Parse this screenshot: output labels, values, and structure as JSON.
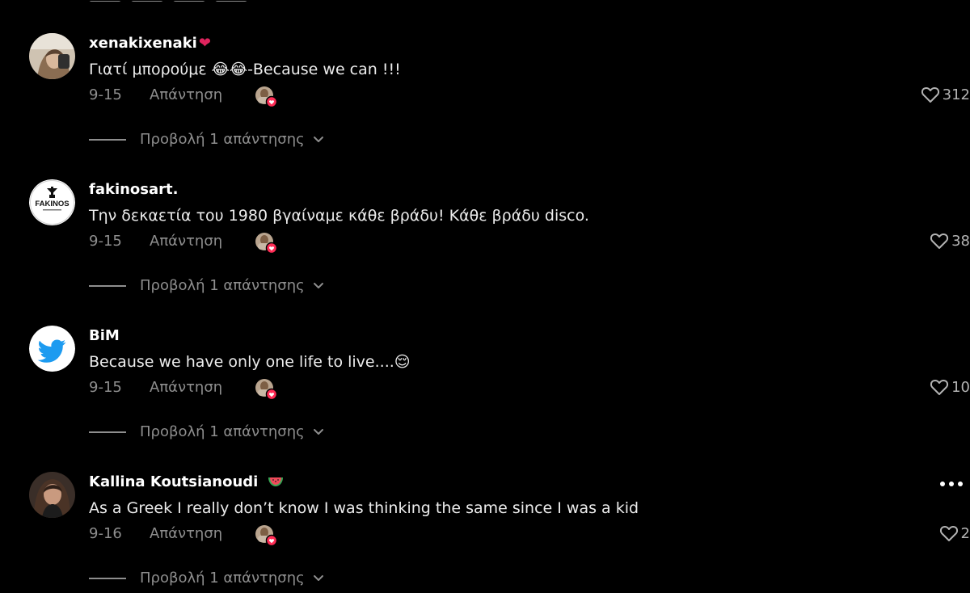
{
  "comments": [
    {
      "username": "xenakixenaki",
      "username_badge": "❤️",
      "text": "Γιατί μπορούμε 😂😂-Because we can !!!",
      "date": "9-15",
      "reply_label": "Απάντηση",
      "likes": "312",
      "view_replies": "Προβολή 1 απάντησης",
      "avatar": "woman-selfie-avatar",
      "has_more_menu": false
    },
    {
      "username": "fakinosart.",
      "username_badge": "",
      "text": "Την δεκαετία του 1980 βγαίναμε κάθε βράδυ! Κάθε βράδυ disco.",
      "date": "9-15",
      "reply_label": "Απάντηση",
      "likes": "38",
      "view_replies": "Προβολή 1 απάντησης",
      "avatar": "fakinos-logo-avatar",
      "avatar_text": "FAKINOS",
      "has_more_menu": false
    },
    {
      "username": "BiM",
      "username_badge": "",
      "text": "Because we have only one life to live....😌",
      "date": "9-15",
      "reply_label": "Απάντηση",
      "likes": "10",
      "view_replies": "Προβολή 1 απάντησης",
      "avatar": "twitter-bird-avatar",
      "has_more_menu": false
    },
    {
      "username": "Kallina Koutsianoudi",
      "username_badge": "🍉",
      "text": "As a Greek I really don’t know I was thinking the same since I was a kid",
      "date": "9-16",
      "reply_label": "Απάντηση",
      "likes": "2",
      "view_replies": "Προβολή 1 απάντησης",
      "avatar": "woman-portrait-avatar",
      "has_more_menu": true
    }
  ],
  "icons": {
    "like": "heart-outline-icon",
    "creator_like": "creator-liked-icon",
    "expand": "chevron-down-icon",
    "more": "more-horizontal-icon"
  },
  "colors": {
    "background": "#000000",
    "primary_text": "#ffffff",
    "secondary_text": "#8e8e8e",
    "like_badge": "#fe2c55",
    "twitter_blue": "#1d9bf0"
  }
}
